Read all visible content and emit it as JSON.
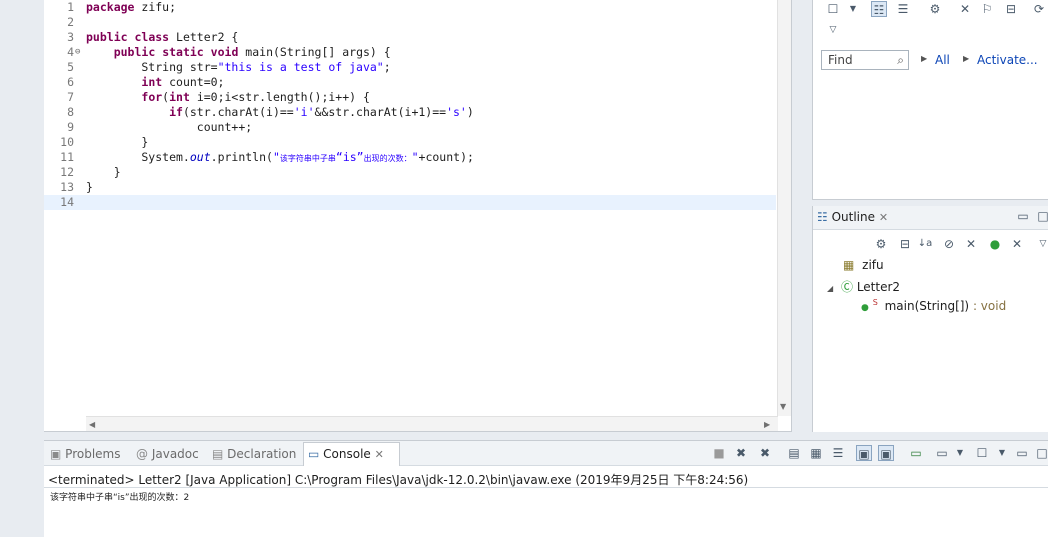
{
  "editor": {
    "lines": [
      {
        "n": "1",
        "fold": "",
        "parts": [
          {
            "c": "kw",
            "t": "package"
          },
          {
            "c": "",
            "t": " zifu;"
          }
        ]
      },
      {
        "n": "2",
        "fold": "",
        "parts": []
      },
      {
        "n": "3",
        "fold": "",
        "parts": [
          {
            "c": "kw",
            "t": "public"
          },
          {
            "c": "",
            "t": " "
          },
          {
            "c": "kw",
            "t": "class"
          },
          {
            "c": "",
            "t": " Letter2 {"
          }
        ]
      },
      {
        "n": "4",
        "fold": "⊖",
        "parts": [
          {
            "c": "",
            "t": "    "
          },
          {
            "c": "kw",
            "t": "public"
          },
          {
            "c": "",
            "t": " "
          },
          {
            "c": "kw",
            "t": "static"
          },
          {
            "c": "",
            "t": " "
          },
          {
            "c": "kw",
            "t": "void"
          },
          {
            "c": "",
            "t": " main(String[] args) {"
          }
        ]
      },
      {
        "n": "5",
        "fold": "",
        "parts": [
          {
            "c": "",
            "t": "        String str="
          },
          {
            "c": "str",
            "t": "\"this is a test of java\""
          },
          {
            "c": "",
            "t": ";"
          }
        ]
      },
      {
        "n": "6",
        "fold": "",
        "parts": [
          {
            "c": "",
            "t": "        "
          },
          {
            "c": "kw",
            "t": "int"
          },
          {
            "c": "",
            "t": " count=0;"
          }
        ]
      },
      {
        "n": "7",
        "fold": "",
        "parts": [
          {
            "c": "",
            "t": "        "
          },
          {
            "c": "kw",
            "t": "for"
          },
          {
            "c": "",
            "t": "("
          },
          {
            "c": "kw",
            "t": "int"
          },
          {
            "c": "",
            "t": " i=0;i<str.length();i++) {"
          }
        ]
      },
      {
        "n": "8",
        "fold": "",
        "parts": [
          {
            "c": "",
            "t": "            "
          },
          {
            "c": "kw",
            "t": "if"
          },
          {
            "c": "",
            "t": "(str.charAt(i)=="
          },
          {
            "c": "str",
            "t": "'i'"
          },
          {
            "c": "",
            "t": "&&str.charAt(i+1)=="
          },
          {
            "c": "str",
            "t": "'s'"
          },
          {
            "c": "",
            "t": ")"
          }
        ]
      },
      {
        "n": "9",
        "fold": "",
        "parts": [
          {
            "c": "",
            "t": "                count++;"
          }
        ]
      },
      {
        "n": "10",
        "fold": "",
        "parts": [
          {
            "c": "",
            "t": "        }"
          }
        ]
      },
      {
        "n": "11",
        "fold": "",
        "parts": [
          {
            "c": "",
            "t": "        System."
          },
          {
            "c": "fld",
            "t": "out"
          },
          {
            "c": "",
            "t": ".println("
          },
          {
            "c": "str",
            "t": "\""
          },
          {
            "c": "str cn",
            "t": "该字符串中子串"
          },
          {
            "c": "str",
            "t": "“is”"
          },
          {
            "c": "str cn",
            "t": "出现的次数："
          },
          {
            "c": "str",
            "t": "\""
          },
          {
            "c": "",
            "t": "+count);"
          }
        ]
      },
      {
        "n": "12",
        "fold": "",
        "parts": [
          {
            "c": "",
            "t": "    }"
          }
        ]
      },
      {
        "n": "13",
        "fold": "",
        "parts": [
          {
            "c": "",
            "t": "}"
          }
        ]
      },
      {
        "n": "14",
        "fold": "",
        "parts": []
      }
    ],
    "current_line": 13
  },
  "right_panel": {
    "find_placeholder": "Find",
    "all_link": "All",
    "activate_link": "Activate..."
  },
  "outline": {
    "tab_label": "Outline",
    "package_name": "zifu",
    "class_name": "Letter2",
    "method_name": "main(String[])",
    "method_return": " : void",
    "static_marker": "S"
  },
  "console": {
    "tabs": {
      "problems": "Problems",
      "javadoc": "Javadoc",
      "declaration": "Declaration",
      "console": "Console"
    },
    "status": "<terminated> Letter2 [Java Application] C:\\Program Files\\Java\\jdk-12.0.2\\bin\\javaw.exe (2019年9月25日 下午8:24:56)",
    "output": "该字符串中子串“is”出现的次数：2"
  },
  "colors": {
    "keyword": "#7f0055",
    "string": "#2a00ff",
    "field": "#0000c0",
    "current_line": "#e8f2fe",
    "link": "#0c45b6"
  }
}
